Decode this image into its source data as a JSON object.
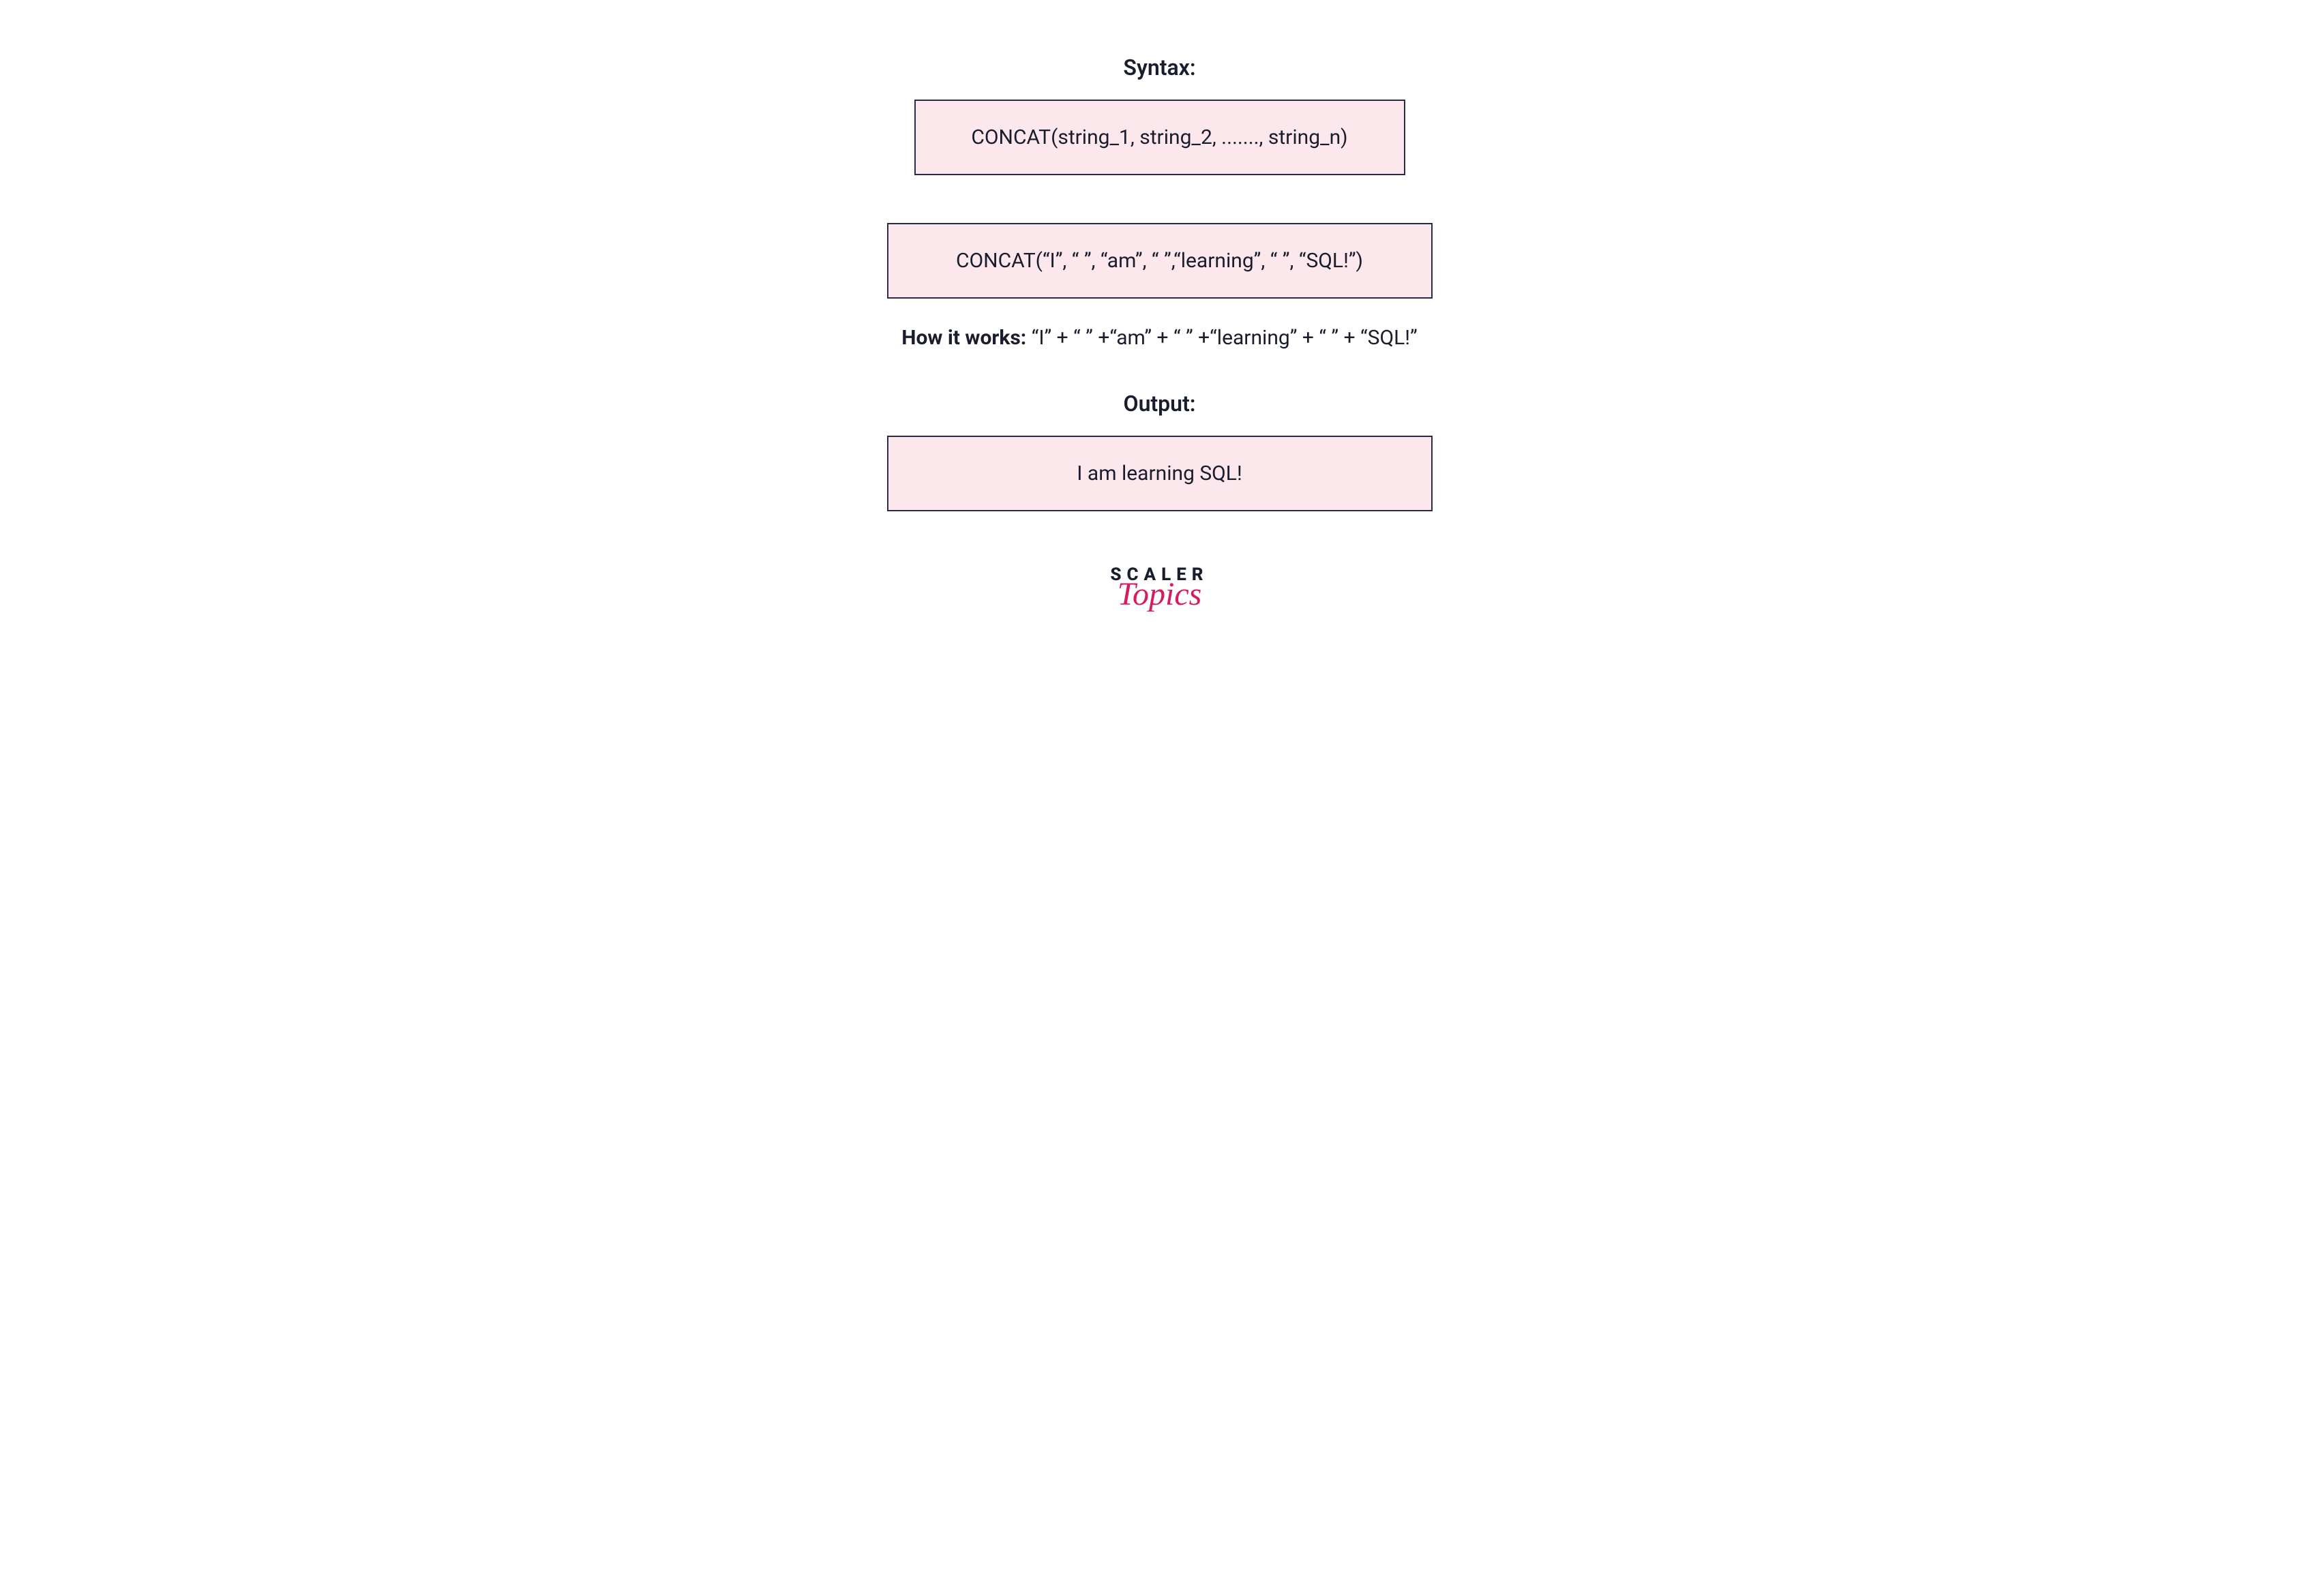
{
  "syntax": {
    "heading": "Syntax:",
    "content": "CONCAT(string_1, string_2, ......., string_n)"
  },
  "example": {
    "content": "CONCAT(“I”, “ ”, “am”, “ ”,“learning”, “ ”, “SQL!”)"
  },
  "howItWorks": {
    "label": "How it works: ",
    "content": "“I” + “ ” +“am” + “ ” +“learning” + “ ” + “SQL!”"
  },
  "output": {
    "heading": "Output:",
    "content": "I am learning SQL!"
  },
  "logo": {
    "line1": "SCALER",
    "line2": "Topics"
  }
}
